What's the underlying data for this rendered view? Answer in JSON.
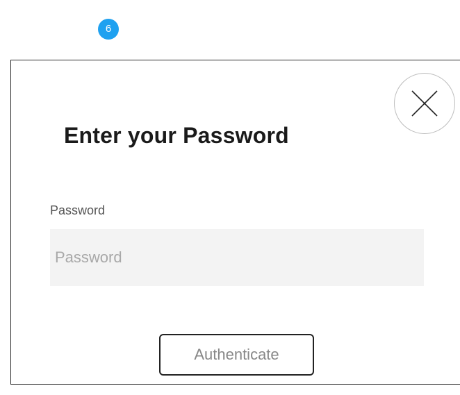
{
  "step_badge": "6",
  "dialog": {
    "title": "Enter your Password",
    "close_icon": "close-x-icon",
    "password_field": {
      "label": "Password",
      "value": "",
      "placeholder": "Password"
    },
    "authenticate_label": "Authenticate"
  },
  "colors": {
    "badge": "#1fa1f0",
    "input_background": "#f3f3f3",
    "border": "#222222"
  }
}
